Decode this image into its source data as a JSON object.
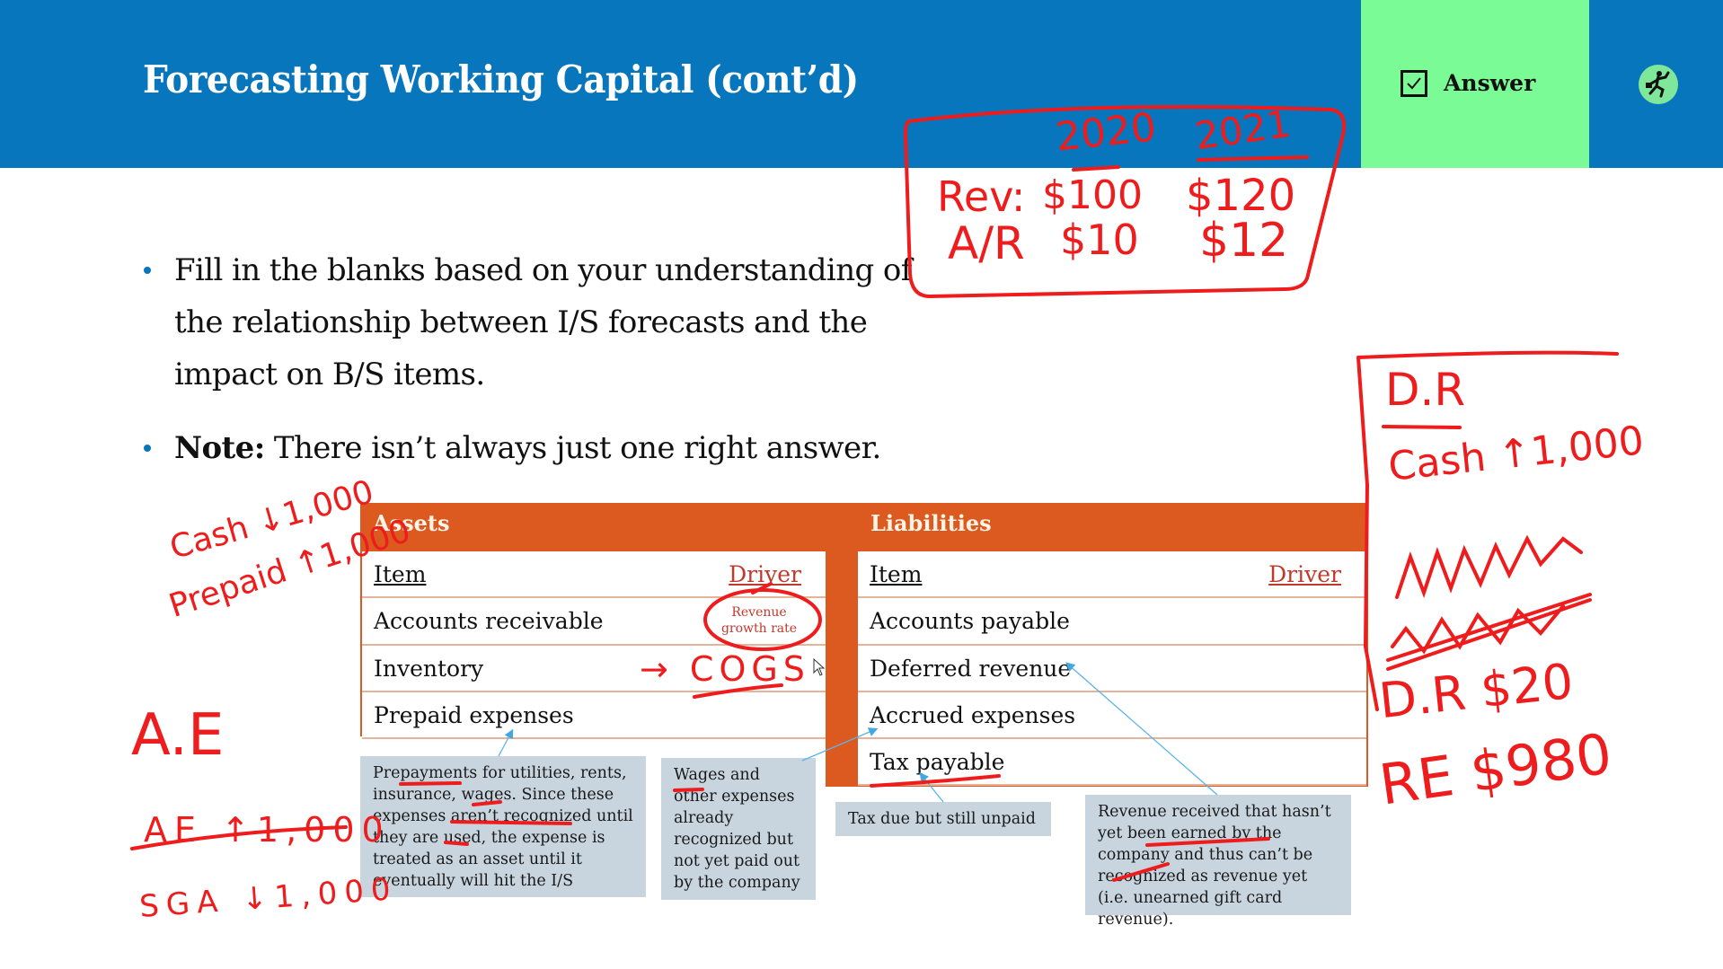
{
  "slide": {
    "title": "Forecasting Working Capital (cont’d)",
    "answer_button": {
      "label": "Answer",
      "icon": "checkbox-checked-icon"
    },
    "logo_icon": "running-businessman-icon",
    "bullets": [
      {
        "text": "Fill in the blanks based on your understanding of the relationship between I/S forecasts and the impact on B/S items."
      },
      {
        "bold_prefix": "Note:",
        "text": " There isn’t always just one right answer."
      }
    ],
    "colors": {
      "header_blue": "#0776bd",
      "answer_green": "#7afb95",
      "table_orange": "#dc5a1f",
      "callout_gray": "#c8d4de",
      "ink_red": "#ee1c1c",
      "driver_red": "#c0392b"
    }
  },
  "assets_table": {
    "header": "Assets",
    "col_item": "Item",
    "col_driver": "Driver",
    "rows": [
      {
        "item": "Accounts receivable",
        "driver": "Revenue growth rate"
      },
      {
        "item": "Inventory",
        "driver": ""
      },
      {
        "item": "Prepaid expenses",
        "driver": ""
      }
    ]
  },
  "liabilities_table": {
    "header": "Liabilities",
    "col_item": "Item",
    "col_driver": "Driver",
    "rows": [
      {
        "item": "Accounts payable",
        "driver": ""
      },
      {
        "item": "Deferred revenue",
        "driver": ""
      },
      {
        "item": "Accrued expenses",
        "driver": ""
      },
      {
        "item": "Tax payable",
        "driver": ""
      }
    ]
  },
  "callouts": {
    "prepaid": "Prepayments for utilities, rents, insurance, wages. Since these expenses aren’t recognized until they are used, the expense is treated as an asset until it eventually will hit the I/S",
    "accrued": "Wages and other expenses already recognized but not yet paid out by the company",
    "tax": "Tax due but still unpaid",
    "deferred": "Revenue received that hasn’t yet been earned by the company and thus can’t be recognized as revenue yet (i.e. unearned gift card revenue)."
  },
  "annotations": {
    "year_box": {
      "years": [
        "2020",
        "2021"
      ],
      "rows": [
        {
          "label": "Rev:",
          "v2020": "$100",
          "v2021": "$120"
        },
        {
          "label": "A/R",
          "v2020": "$10",
          "v2021": "$12"
        }
      ]
    },
    "inventory_driver": "→ COGS",
    "left_notes": {
      "cash": "Cash ↓1,000",
      "prepaid": "Prepaid ↑1,000",
      "ae": "A.E",
      "ae_struck": "AE ↑1,000",
      "sga": "SGA ↓1,000"
    },
    "right_notes": {
      "dr_heading": "D.R",
      "cash": "Cash ↑1,000",
      "dr": "D.R $20",
      "re": "RE $980"
    }
  }
}
